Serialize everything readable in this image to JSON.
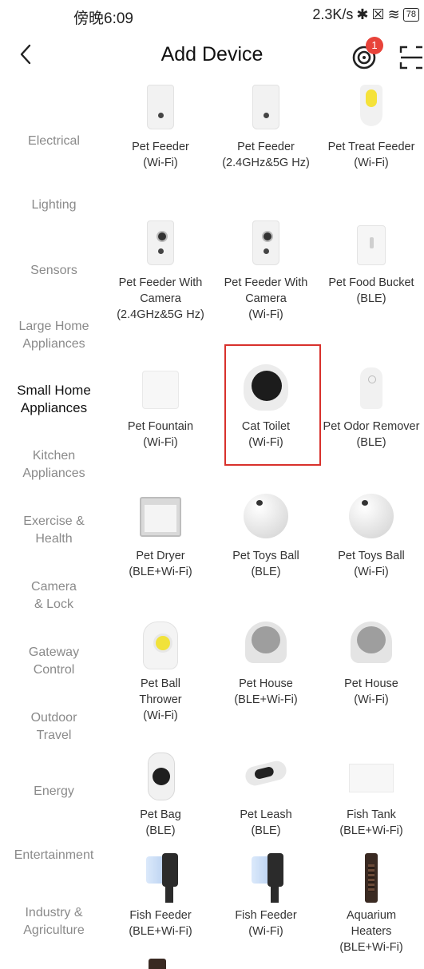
{
  "status_bar": {
    "time": "傍晚6:09",
    "net_speed": "2.3K/s",
    "battery": "78"
  },
  "header": {
    "title": "Add Device",
    "notification_count": "1"
  },
  "categories": [
    {
      "label": "Electrical",
      "active": false
    },
    {
      "label": "Lighting",
      "active": false
    },
    {
      "label": "Sensors",
      "active": false
    },
    {
      "label": "Large Home Appliances",
      "active": false
    },
    {
      "label": "Small Home Appliances",
      "active": true
    },
    {
      "label": "Kitchen Appliances",
      "active": false
    },
    {
      "label": "Exercise & Health",
      "active": false
    },
    {
      "label": "Camera & Lock",
      "active": false
    },
    {
      "label": "Gateway Control",
      "active": false
    },
    {
      "label": "Outdoor Travel",
      "active": false
    },
    {
      "label": "Energy",
      "active": false
    },
    {
      "label": "Entertainment",
      "active": false
    },
    {
      "label": "Industry & Agriculture",
      "active": false
    }
  ],
  "devices": [
    {
      "name": "Pet Feeder",
      "sub": "(Wi-Fi)",
      "icon": "pet-feeder"
    },
    {
      "name": "Pet Feeder",
      "sub": "(2.4GHz&5G Hz)",
      "icon": "pet-feeder"
    },
    {
      "name": "Pet Treat Feeder",
      "sub": "(Wi-Fi)",
      "icon": "pet-treat-feeder"
    },
    {
      "name": "Pet Feeder With Camera",
      "sub": "(2.4GHz&5G Hz)",
      "icon": "pet-feeder-camera"
    },
    {
      "name": "Pet Feeder With Camera",
      "sub": "(Wi-Fi)",
      "icon": "pet-feeder-camera"
    },
    {
      "name": "Pet Food Bucket",
      "sub": "(BLE)",
      "icon": "pet-food-bucket"
    },
    {
      "name": "Pet Fountain",
      "sub": "(Wi-Fi)",
      "icon": "pet-fountain"
    },
    {
      "name": "Cat Toilet",
      "sub": "(Wi-Fi)",
      "icon": "cat-toilet",
      "highlighted": true
    },
    {
      "name": "Pet Odor Remover",
      "sub": "(BLE)",
      "icon": "pet-odor-remover"
    },
    {
      "name": "Pet Dryer",
      "sub": "(BLE+Wi-Fi)",
      "icon": "pet-dryer"
    },
    {
      "name": "Pet Toys Ball",
      "sub": "(BLE)",
      "icon": "pet-toys-ball"
    },
    {
      "name": "Pet Toys Ball",
      "sub": "(Wi-Fi)",
      "icon": "pet-toys-ball"
    },
    {
      "name": "Pet Ball Thrower",
      "sub": "(Wi-Fi)",
      "icon": "pet-ball-thrower"
    },
    {
      "name": "Pet House",
      "sub": "(BLE+Wi-Fi)",
      "icon": "pet-house"
    },
    {
      "name": "Pet House",
      "sub": "(Wi-Fi)",
      "icon": "pet-house"
    },
    {
      "name": "Pet Bag",
      "sub": "(BLE)",
      "icon": "pet-bag"
    },
    {
      "name": "Pet Leash",
      "sub": "(BLE)",
      "icon": "pet-leash"
    },
    {
      "name": "Fish Tank",
      "sub": "(BLE+Wi-Fi)",
      "icon": "fish-tank"
    },
    {
      "name": "Fish Feeder",
      "sub": "(BLE+Wi-Fi)",
      "icon": "fish-feeder"
    },
    {
      "name": "Fish Feeder",
      "sub": "(Wi-Fi)",
      "icon": "fish-feeder"
    },
    {
      "name": "Aquarium Heaters",
      "sub": "(BLE+Wi-Fi)",
      "icon": "aquarium-heater"
    }
  ],
  "colors": {
    "accent_red": "#d8312c",
    "badge": "#e8433a",
    "active_text": "#111111",
    "inactive_text": "#8a8a8a"
  }
}
